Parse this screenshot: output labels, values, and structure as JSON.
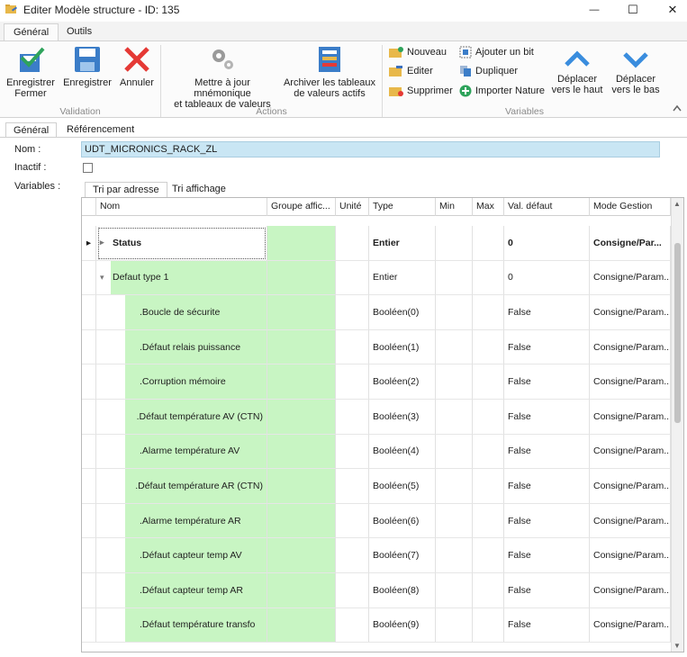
{
  "window": {
    "title": "Editer Modèle structure - ID: 135",
    "controls": {
      "minimize": "—",
      "maximize": "☐",
      "close": "✕"
    }
  },
  "ribbon_tabs": [
    {
      "label": "Général"
    },
    {
      "label": "Outils"
    }
  ],
  "ribbon": {
    "validation": {
      "group_label": "Validation",
      "save_close": "Enregistrer\nFermer",
      "save": "Enregistrer",
      "cancel": "Annuler"
    },
    "actions": {
      "group_label": "Actions",
      "update_mnemonic": "Mettre à jour mnémonique\net tableaux de valeurs",
      "archive_tables": "Archiver les tableaux\nde valeurs actifs"
    },
    "variables": {
      "group_label": "Variables",
      "new": "Nouveau",
      "edit": "Editer",
      "delete": "Supprimer",
      "add_bit": "Ajouter un bit",
      "duplicate": "Dupliquer",
      "import_nature": "Importer Nature",
      "move_up": "Déplacer\nvers le haut",
      "move_down": "Déplacer\nvers le bas"
    },
    "collapse_icon": "chevron-up-icon"
  },
  "sub_tabs": [
    {
      "label": "Général"
    },
    {
      "label": "Référencement"
    }
  ],
  "form": {
    "nom_label": "Nom :",
    "nom_value": "UDT_MICRONICS_RACK_ZL",
    "inactif_label": "Inactif :",
    "inactif_checked": false,
    "variables_label": "Variables :"
  },
  "variable_tabs": [
    {
      "label": "Tri par adresse"
    },
    {
      "label": "Tri affichage"
    }
  ],
  "grid": {
    "columns": [
      "Nom",
      "Groupe affic...",
      "Unité",
      "Type",
      "Min",
      "Max",
      "Val. défaut",
      "Mode Gestion"
    ],
    "rows": [
      {
        "indent": 0,
        "expander": "▸",
        "current": true,
        "bold": true,
        "name": "Status",
        "groupe": "",
        "unite": "",
        "type": "Entier",
        "min": "",
        "max": "",
        "val_defaut": "0",
        "mode": "Consigne/Par..."
      },
      {
        "indent": 1,
        "expander": "▾",
        "current": false,
        "bold": false,
        "name": "Defaut type 1",
        "groupe": "",
        "unite": "",
        "type": "Entier",
        "min": "",
        "max": "",
        "val_defaut": "0",
        "mode": "Consigne/Param..."
      },
      {
        "indent": 2,
        "expander": "",
        "current": false,
        "bold": false,
        "name": ".Boucle de sécurite",
        "groupe": "",
        "unite": "",
        "type": "Booléen(0)",
        "min": "",
        "max": "",
        "val_defaut": "False",
        "mode": "Consigne/Param..."
      },
      {
        "indent": 2,
        "expander": "",
        "current": false,
        "bold": false,
        "name": ".Défaut relais puissance",
        "groupe": "",
        "unite": "",
        "type": "Booléen(1)",
        "min": "",
        "max": "",
        "val_defaut": "False",
        "mode": "Consigne/Param..."
      },
      {
        "indent": 2,
        "expander": "",
        "current": false,
        "bold": false,
        "name": ".Corruption mémoire",
        "groupe": "",
        "unite": "",
        "type": "Booléen(2)",
        "min": "",
        "max": "",
        "val_defaut": "False",
        "mode": "Consigne/Param..."
      },
      {
        "indent": 2,
        "expander": "",
        "current": false,
        "bold": false,
        "name": ".Défaut température AV (CTN)",
        "groupe": "",
        "unite": "",
        "type": "Booléen(3)",
        "min": "",
        "max": "",
        "val_defaut": "False",
        "mode": "Consigne/Param..."
      },
      {
        "indent": 2,
        "expander": "",
        "current": false,
        "bold": false,
        "name": ".Alarme température AV",
        "groupe": "",
        "unite": "",
        "type": "Booléen(4)",
        "min": "",
        "max": "",
        "val_defaut": "False",
        "mode": "Consigne/Param..."
      },
      {
        "indent": 2,
        "expander": "",
        "current": false,
        "bold": false,
        "name": ".Défaut température AR (CTN)",
        "groupe": "",
        "unite": "",
        "type": "Booléen(5)",
        "min": "",
        "max": "",
        "val_defaut": "False",
        "mode": "Consigne/Param..."
      },
      {
        "indent": 2,
        "expander": "",
        "current": false,
        "bold": false,
        "name": ".Alarme température AR",
        "groupe": "",
        "unite": "",
        "type": "Booléen(6)",
        "min": "",
        "max": "",
        "val_defaut": "False",
        "mode": "Consigne/Param..."
      },
      {
        "indent": 2,
        "expander": "",
        "current": false,
        "bold": false,
        "name": ".Défaut capteur temp AV",
        "groupe": "",
        "unite": "",
        "type": "Booléen(7)",
        "min": "",
        "max": "",
        "val_defaut": "False",
        "mode": "Consigne/Param..."
      },
      {
        "indent": 2,
        "expander": "",
        "current": false,
        "bold": false,
        "name": ".Défaut capteur temp AR",
        "groupe": "",
        "unite": "",
        "type": "Booléen(8)",
        "min": "",
        "max": "",
        "val_defaut": "False",
        "mode": "Consigne/Param..."
      },
      {
        "indent": 2,
        "expander": "",
        "current": false,
        "bold": false,
        "name": ".Défaut température transfo",
        "groupe": "",
        "unite": "",
        "type": "Booléen(9)",
        "min": "",
        "max": "",
        "val_defaut": "False",
        "mode": "Consigne/Param..."
      }
    ]
  },
  "colors": {
    "green_fill": "#c8f5c3",
    "input_fill": "#c9e6f4",
    "accent_blue": "#3a8dde",
    "cancel_red": "#e53935",
    "save_green": "#2ea35b"
  }
}
